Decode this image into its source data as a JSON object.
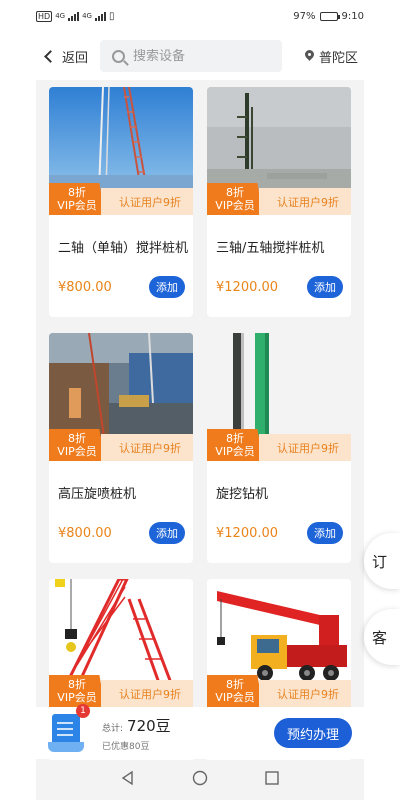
{
  "status_bar": {
    "left_text": "HD",
    "net_1": "4G",
    "net_2": "4G",
    "battery": "97%",
    "time": "9:10"
  },
  "header": {
    "back_label": "返回",
    "search_placeholder": "搜索设备",
    "location": "普陀区"
  },
  "products": [
    {
      "title": "二轴（单轴）搅拌桩机",
      "price": "¥800.00",
      "vip_discount": "8折",
      "vip_label": "VIP会员",
      "cert_label": "认证用户9折",
      "add_label": "添加",
      "image": "blue-sky-pile-rig"
    },
    {
      "title": "三轴/五轴搅拌桩机",
      "price": "¥1200.00",
      "vip_discount": "8折",
      "vip_label": "VIP会员",
      "cert_label": "认证用户9折",
      "add_label": "添加",
      "image": "grey-sky-pile-rig"
    },
    {
      "title": "高压旋喷桩机",
      "price": "¥800.00",
      "vip_discount": "8折",
      "vip_label": "VIP会员",
      "cert_label": "认证用户9折",
      "add_label": "添加",
      "image": "construction-site"
    },
    {
      "title": "旋挖钻机",
      "price": "¥1200.00",
      "vip_discount": "8折",
      "vip_label": "VIP会员",
      "cert_label": "认证用户9折",
      "add_label": "添加",
      "image": "green-drill-mast"
    },
    {
      "title": "",
      "price": "",
      "vip_discount": "8折",
      "vip_label": "VIP会员",
      "cert_label": "认证用户9折",
      "add_label": "",
      "image": "red-crawler-crane"
    },
    {
      "title": "",
      "price": "",
      "vip_discount": "8折",
      "vip_label": "VIP会员",
      "cert_label": "认证用户9折",
      "add_label": "",
      "image": "red-truck-crane"
    }
  ],
  "side_tabs": [
    "订",
    "客"
  ],
  "bottom_bar": {
    "cart_count": "1",
    "total_label": "总计:",
    "total_value": "720豆",
    "discount": "已优惠80豆",
    "book_label": "预约办理"
  },
  "colors": {
    "accent_blue": "#1d64d8",
    "vip_orange": "#ef7b1c",
    "price_orange": "#e98419",
    "cert_bg": "#fbe3cc"
  }
}
